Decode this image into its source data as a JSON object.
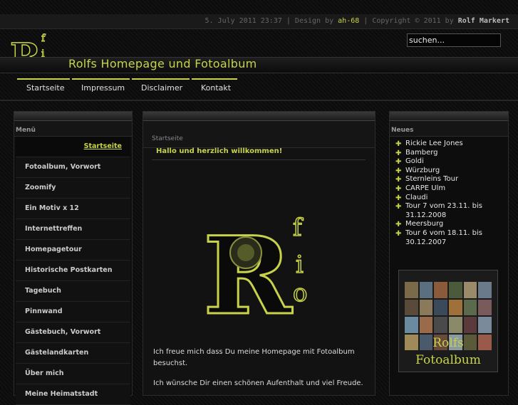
{
  "topbar": {
    "date": "5. July 2011 23:37",
    "sep1": " | Design by ",
    "designer": "ah-68",
    "sep2": " | Copyright © 2011 by ",
    "owner": "Rolf Markert"
  },
  "search": {
    "value": "suchen..."
  },
  "site": {
    "title": "Rolfs Homepage und Fotoalbum"
  },
  "nav": [
    {
      "label": "Startseite"
    },
    {
      "label": "Impressum"
    },
    {
      "label": "Disclaimer"
    },
    {
      "label": "Kontakt"
    }
  ],
  "menu": {
    "title": "Menü",
    "items": [
      {
        "label": "Startseite"
      },
      {
        "label": "Fotoalbum, Vorwort"
      },
      {
        "label": "Zoomify"
      },
      {
        "label": "Ein Motiv x 12"
      },
      {
        "label": "Internettreffen"
      },
      {
        "label": "Homepagetour"
      },
      {
        "label": "Historische Postkarten"
      },
      {
        "label": "Tagebuch"
      },
      {
        "label": "Pinnwand"
      },
      {
        "label": "Gästebuch, Vorwort"
      },
      {
        "label": "Gästelandkarten"
      },
      {
        "label": "Über mich"
      },
      {
        "label": "Meine Heimatstadt"
      }
    ]
  },
  "main": {
    "title": "Startseite",
    "welcome": "Hallo und herzlich willkommen!",
    "para1": "Ich freue mich dass Du meine Homepage mit Fotoalbum besuchst.",
    "para2": "Ich wünsche Dir einen schönen Aufenthalt und viel Freude."
  },
  "news": {
    "title": "Neues",
    "items": [
      {
        "label": "Rickie Lee Jones",
        "cont": ""
      },
      {
        "label": "Bamberg",
        "cont": ""
      },
      {
        "label": "Goldi",
        "cont": ""
      },
      {
        "label": "Würzburg",
        "cont": ""
      },
      {
        "label": "Sternleins Tour",
        "cont": ""
      },
      {
        "label": "CARPE Ulm",
        "cont": ""
      },
      {
        "label": "Claudi",
        "cont": ""
      },
      {
        "label": "Tour 7 vom 23.11. bis",
        "cont": "31.12.2008"
      },
      {
        "label": "Meersburg",
        "cont": ""
      },
      {
        "label": "Tour 6 vom 18.11. bis",
        "cont": "30.12.2007"
      }
    ],
    "thumb_line1": "Rolfs",
    "thumb_line2": "Fotoalbum"
  },
  "colors": {
    "accent": "#c8d34a",
    "background": "#070707"
  }
}
